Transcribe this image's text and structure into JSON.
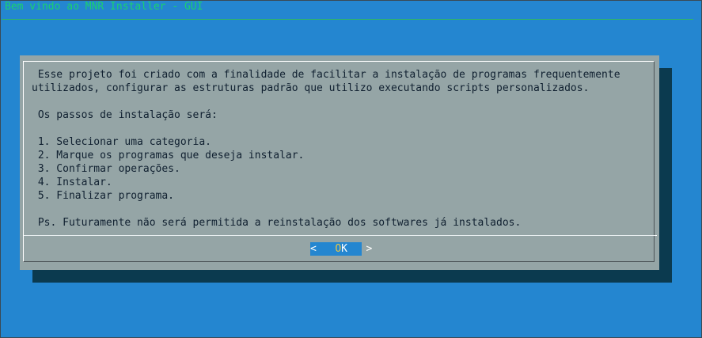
{
  "backtitle": "Bem vindo ao MNR Installer - GUI",
  "dialog": {
    "lines": [
      " Esse projeto foi criado com a finalidade de facilitar a instalação de programas frequentemente",
      "utilizados, configurar as estruturas padrão que utilizo executando scripts personalizados.",
      "",
      " Os passos de instalação será:",
      "",
      " 1. Selecionar uma categoria.",
      " 2. Marque os programas que deseja instalar.",
      " 3. Confirmar operações.",
      " 4. Instalar.",
      " 5. Finalizar programa.",
      "",
      " Ps. Futuramente não será permitida a reinstalação dos softwares já instalados."
    ],
    "ok_button": {
      "left": "<",
      "hotkey": "O",
      "rest": "K",
      "right": ">"
    }
  }
}
